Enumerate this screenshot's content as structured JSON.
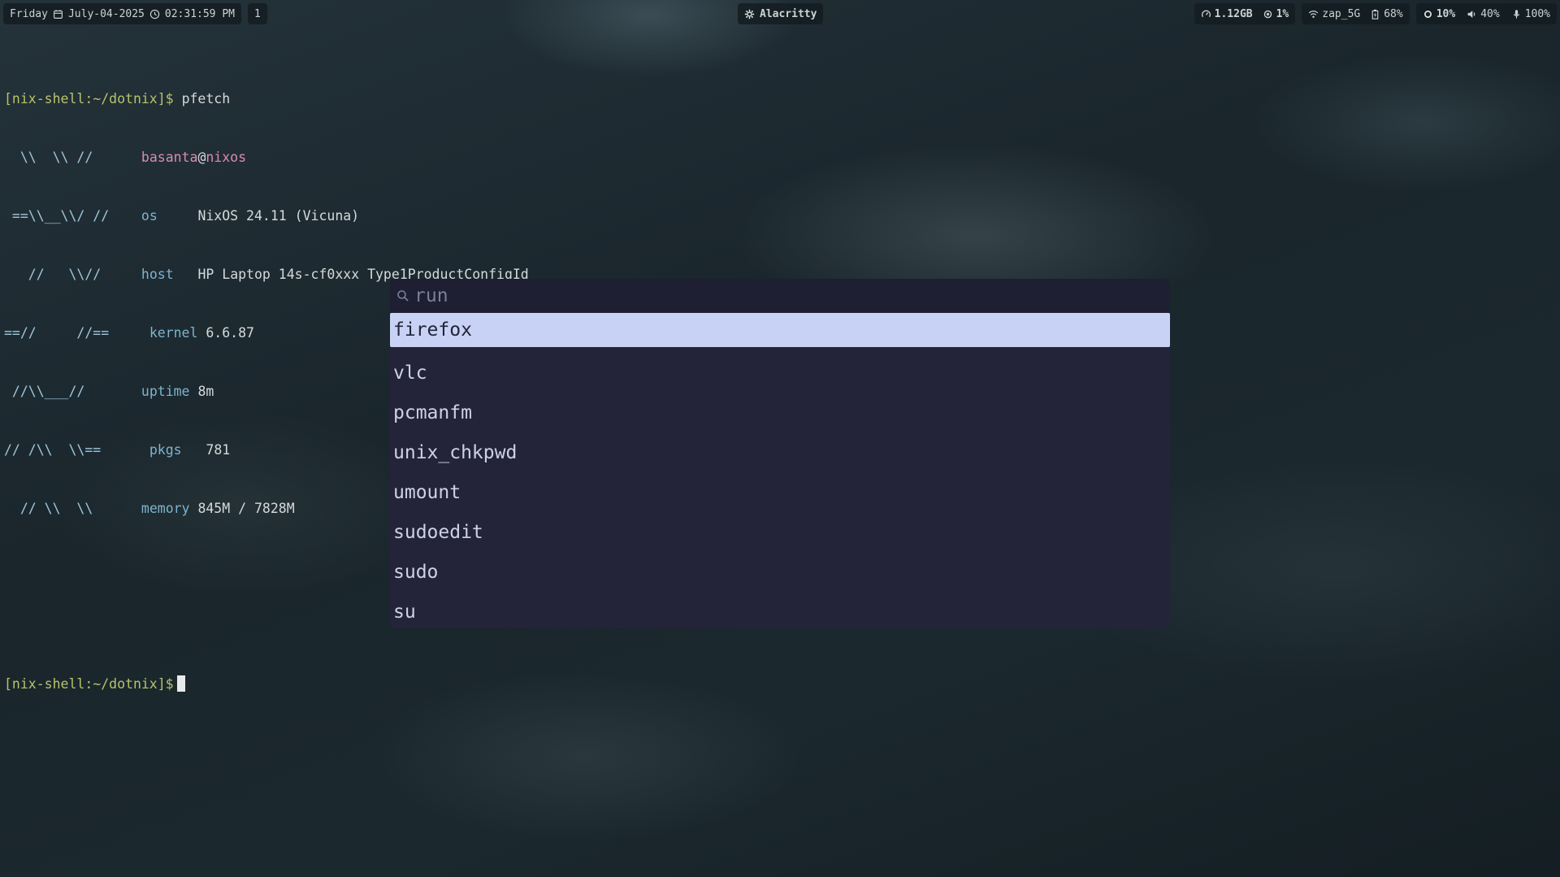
{
  "topbar": {
    "day": "Friday",
    "date": "July-04-2025",
    "time": "02:31:59 PM",
    "workspace": "1",
    "window_title": "Alacritty",
    "memory": "1.12GB",
    "cpu": "1%",
    "wifi": "zap_5G",
    "battery": "68%",
    "brightness": "10%",
    "volume": "40%",
    "mic": "100%",
    "icons": [
      "calendar-icon",
      "clock-icon",
      "gear-icon",
      "memory-icon",
      "cpu-icon",
      "wifi-icon",
      "battery-icon",
      "brightness-icon",
      "volume-icon",
      "microphone-icon"
    ]
  },
  "terminal": {
    "prompt": "[nix-shell:~/dotnix]$",
    "command": "pfetch",
    "user": "basanta",
    "at": "@",
    "host": "nixos",
    "art": [
      "  \\\\  \\\\ //",
      " ==\\\\__\\\\/ //",
      "   //   \\\\//",
      "==//     //==",
      " //\\\\___//",
      "// /\\\\  \\\\==",
      "  // \\\\  \\\\"
    ],
    "rows": [
      {
        "key": "os",
        "value": "NixOS 24.11 (Vicuna)"
      },
      {
        "key": "host",
        "value": "HP Laptop 14s-cf0xxx Type1ProductConfigId"
      },
      {
        "key": "kernel",
        "value": "6.6.87"
      },
      {
        "key": "uptime",
        "value": "8m"
      },
      {
        "key": "pkgs",
        "value": "781"
      },
      {
        "key": "memory",
        "value": "845M / 7828M"
      }
    ]
  },
  "launcher": {
    "placeholder": "run",
    "items": [
      "firefox",
      "vlc",
      "pcmanfm",
      "unix_chkpwd",
      "umount",
      "sudoedit",
      "sudo",
      "su"
    ],
    "selected_color": "#c8d2f4"
  }
}
